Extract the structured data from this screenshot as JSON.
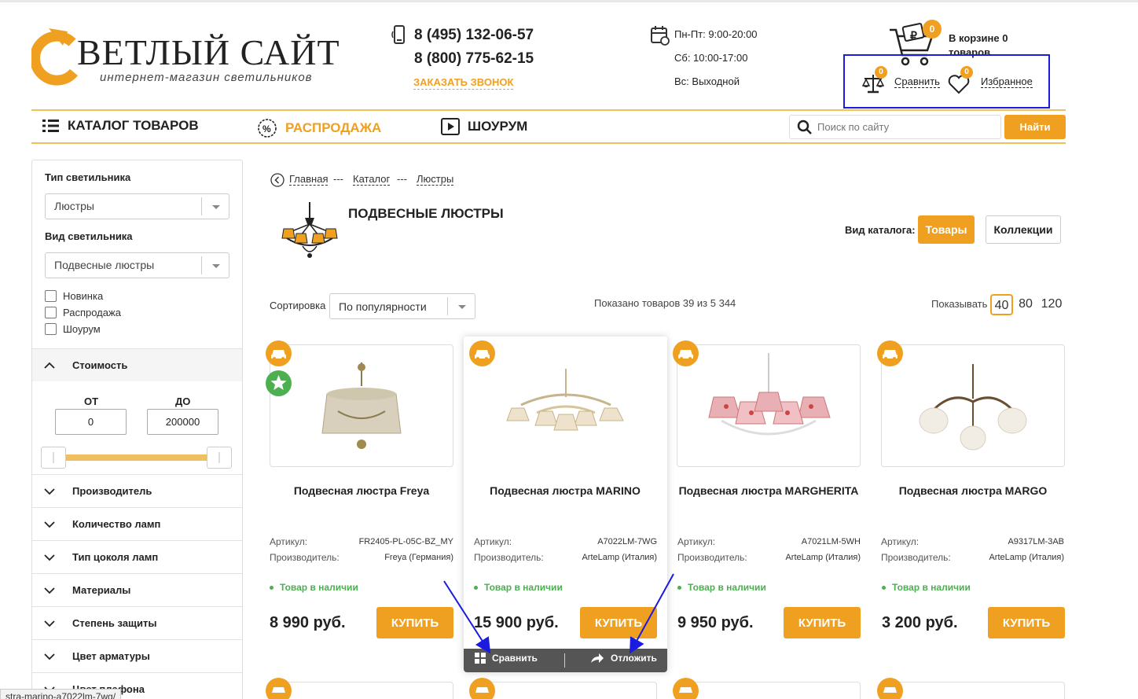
{
  "header": {
    "logo_main": "ВЕТЛЫЙ САЙТ",
    "logo_sub": "интернет-магазин   светильников",
    "phone1": "8 (495) 132-06-57",
    "phone2": "8 (800) 775-62-15",
    "callback": "ЗАКАЗАТЬ ЗВОНОК",
    "hours_weekday": "Пн-Пт: 9:00-20:00",
    "hours_sat": "Сб: 10:00-17:00",
    "hours_sun": "Вс: Выходной",
    "cart_count": "0",
    "cart_text": "В корзине 0 товаров",
    "compare_count": "0",
    "compare_label": "Сравнить",
    "fav_count": "0",
    "fav_label": "Избранное"
  },
  "nav": {
    "catalog": "КАТАЛОГ ТОВАРОВ",
    "sale": "РАСПРОДАЖА",
    "showroom": "ШОУРУМ",
    "search_placeholder": "Поиск по сайту",
    "search_button": "Найти"
  },
  "sidebar": {
    "type_label": "Тип светильника",
    "type_value": "Люстры",
    "kind_label": "Вид светильника",
    "kind_value": "Подвесные люстры",
    "checkboxes": [
      "Новинка",
      "Распродажа",
      "Шоурум"
    ],
    "price_section": "Стоимость",
    "price_from_label": "ОТ",
    "price_to_label": "ДО",
    "price_from": "0",
    "price_to": "200000",
    "sections": [
      "Производитель",
      "Количество ламп",
      "Тип цоколя ламп",
      "Материалы",
      "Степень защиты",
      "Цвет арматуры",
      "Цвет плафона"
    ]
  },
  "breadcrumbs": [
    "Главная",
    "Каталог",
    "Люстры"
  ],
  "breadcrumb_sep": "---",
  "page_title": "ПОДВЕСНЫЕ ЛЮСТРЫ",
  "view": {
    "label": "Вид каталога:",
    "products": "Товары",
    "collections": "Коллекции"
  },
  "sorting": {
    "label": "Сортировка",
    "value": "По популярности"
  },
  "shown_text": "Показано товаров 39 из 5 344",
  "per_page": {
    "label": "Показывать",
    "options": [
      "40",
      "80",
      "120"
    ],
    "selected": "40"
  },
  "labels": {
    "article": "Артикул:",
    "maker": "Производитель:",
    "in_stock": "Товар в наличии",
    "buy": "КУПИТЬ",
    "compare": "Сравнить",
    "defer": "Отложить"
  },
  "products": [
    {
      "name": "Подвесная люстра Freya",
      "article": "FR2405-PL-05C-BZ_MY",
      "maker": "Freya (Германия)",
      "price": "8 990 руб."
    },
    {
      "name": "Подвесная люстра MARINO",
      "article": "A7022LM-7WG",
      "maker": "ArteLamp (Италия)",
      "price": "15 900 руб."
    },
    {
      "name": "Подвесная люстра MARGHERITA",
      "article": "A7021LM-5WH",
      "maker": "ArteLamp (Италия)",
      "price": "9 950 руб."
    },
    {
      "name": "Подвесная люстра MARGO",
      "article": "A9317LM-3AB",
      "maker": "ArteLamp (Италия)",
      "price": "3 200 руб."
    }
  ],
  "status_url": "stra-marino-a7022lm-7wg/",
  "colors": {
    "accent": "#f0a020",
    "in_stock": "#4caf50",
    "highlight_box": "#1a1ae0"
  }
}
